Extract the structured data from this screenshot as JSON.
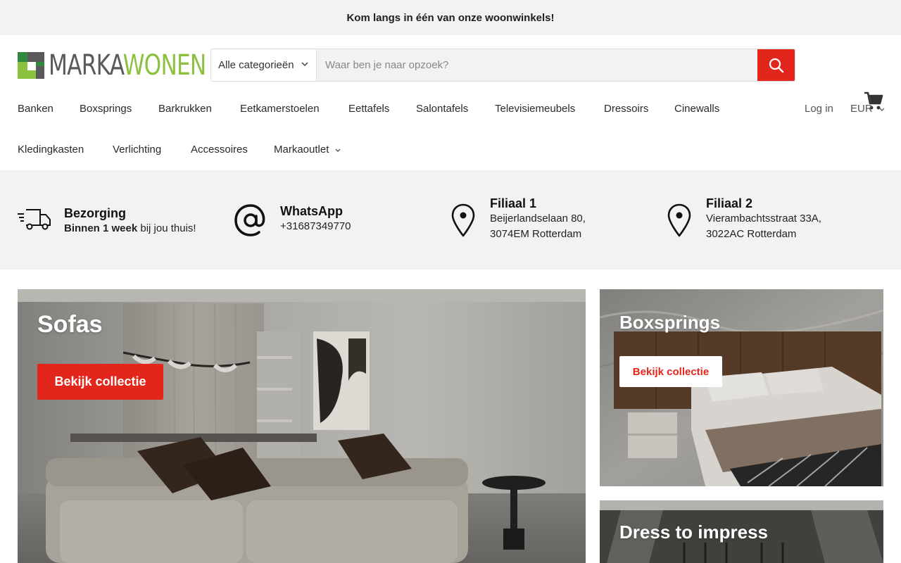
{
  "announcement": "Kom langs in één van onze woonwinkels!",
  "brand": {
    "part1": "MARKA",
    "part2": "WONEN",
    "accent": "#8cc13f",
    "gray": "#5a5a5a",
    "red": "#e3261b"
  },
  "search": {
    "category": "Alle categorieën",
    "placeholder": "Waar ben je naar opzoek?"
  },
  "nav": {
    "items": [
      "Banken",
      "Boxsprings",
      "Barkrukken",
      "Eetkamerstoelen",
      "Eettafels",
      "Salontafels",
      "Televisiemeubels",
      "Dressoirs",
      "Cinewalls",
      "Kledingkasten",
      "Verlichting",
      "Accessoires",
      "Markaoutlet"
    ],
    "login": "Log in",
    "currency": "EUR"
  },
  "info": {
    "delivery": {
      "title": "Bezorging",
      "bold": "Binnen 1 week",
      "rest": " bij jou thuis!",
      "icon": "truck-icon"
    },
    "whatsapp": {
      "title": "WhatsApp",
      "phone": "+31687349770",
      "icon": "at-icon"
    },
    "branch1": {
      "title": "Filiaal 1",
      "line1": "Beijerlandselaan 80,",
      "line2": "3074EM Rotterdam",
      "icon": "location-pin-icon"
    },
    "branch2": {
      "title": "Filiaal 2",
      "line1": "Vierambachtsstraat 33A,",
      "line2": "3022AC Rotterdam",
      "icon": "location-pin-icon"
    }
  },
  "heroes": {
    "sofas": {
      "title": "Sofas",
      "button": "Bekijk collectie"
    },
    "boxsprings": {
      "title": "Boxsprings",
      "button": "Bekijk collectie"
    },
    "dress": {
      "title": "Dress to impress"
    }
  }
}
